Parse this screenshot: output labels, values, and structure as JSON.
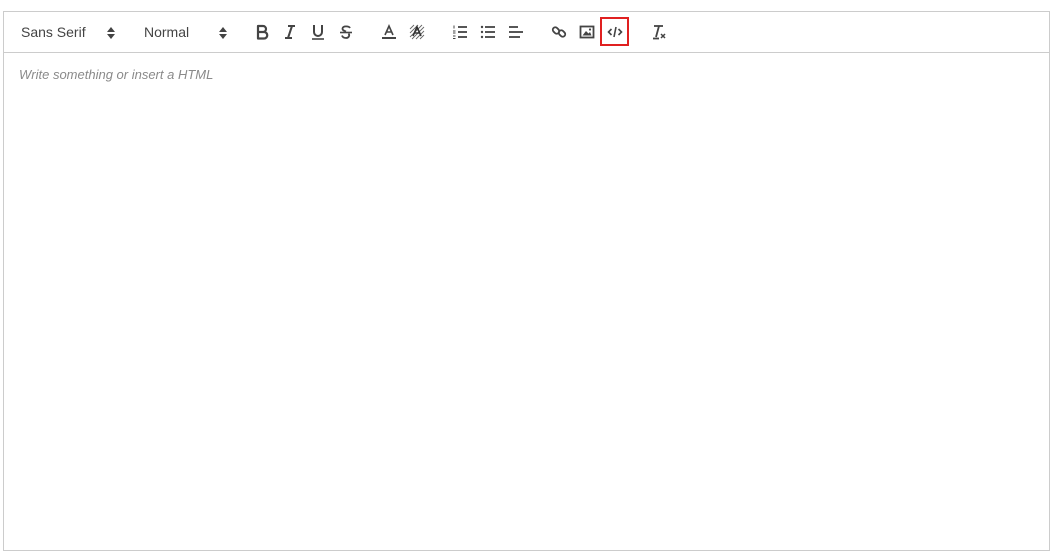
{
  "toolbar": {
    "font_picker": {
      "value": "Sans Serif"
    },
    "size_picker": {
      "value": "Normal"
    },
    "buttons": [
      {
        "name": "bold",
        "icon": "bold-icon"
      },
      {
        "name": "italic",
        "icon": "italic-icon"
      },
      {
        "name": "underline",
        "icon": "underline-icon"
      },
      {
        "name": "strike",
        "icon": "strikethrough-icon"
      },
      {
        "name": "color",
        "icon": "text-color-icon"
      },
      {
        "name": "background",
        "icon": "background-color-icon"
      },
      {
        "name": "ordered-list",
        "icon": "ordered-list-icon"
      },
      {
        "name": "bullet-list",
        "icon": "bullet-list-icon"
      },
      {
        "name": "align",
        "icon": "align-left-icon"
      },
      {
        "name": "link",
        "icon": "link-icon"
      },
      {
        "name": "image",
        "icon": "image-icon"
      },
      {
        "name": "code-view",
        "icon": "code-icon",
        "highlighted": true
      },
      {
        "name": "clean",
        "icon": "clear-format-icon"
      }
    ],
    "highlight_color": "#e02020",
    "icon_color": "#444444"
  },
  "editor": {
    "placeholder": "Write something or insert a HTML",
    "border_color": "#cccccc"
  }
}
